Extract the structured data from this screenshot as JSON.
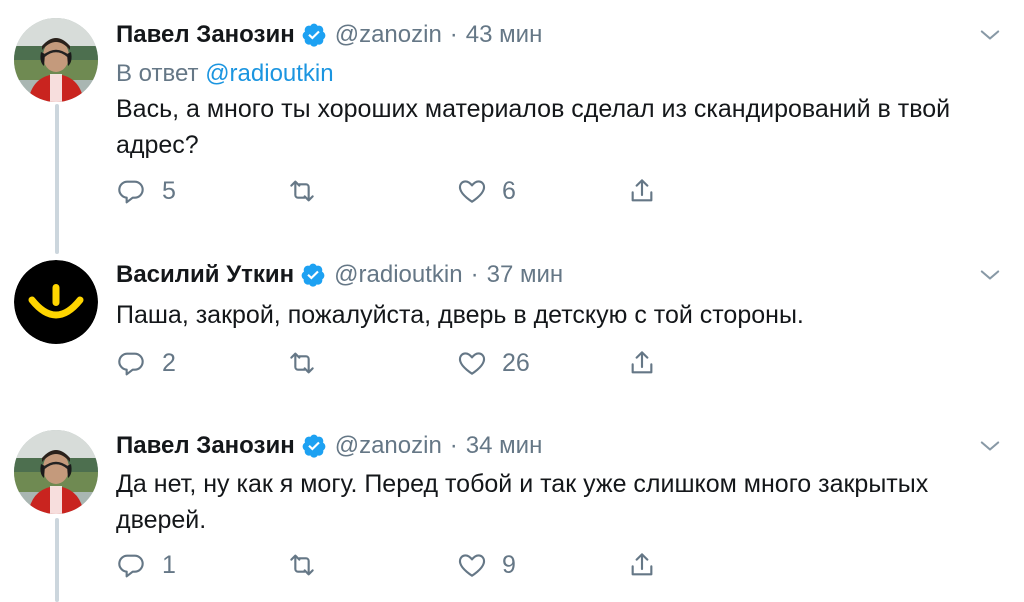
{
  "tweets": [
    {
      "author": "Павел Занозин",
      "handle": "@zanozin",
      "separator": "·",
      "time": "43 мин",
      "reply_prefix": "В ответ",
      "reply_mention": "@radioutkin",
      "text": "Вась, а много ты хороших материалов сделал из скандирований в твой адрес?",
      "replies": "5",
      "retweets": "",
      "likes": "6",
      "avatar_icon": "person-photo-avatar",
      "verified_icon": "verified-badge-icon"
    },
    {
      "author": "Василий Уткин",
      "handle": "@radioutkin",
      "separator": "·",
      "time": "37 мин",
      "text": "Паша, закрой, пожалуйста, дверь в детскую с той стороны.",
      "replies": "2",
      "retweets": "",
      "likes": "26",
      "avatar_icon": "yellow-smile-logo-avatar",
      "verified_icon": "verified-badge-icon"
    },
    {
      "author": "Павел Занозин",
      "handle": "@zanozin",
      "separator": "·",
      "time": "34 мин",
      "text": "Да нет, ну как я могу. Перед тобой и так уже слишком много закрытых дверей.",
      "replies": "1",
      "retweets": "",
      "likes": "9",
      "avatar_icon": "person-photo-avatar",
      "verified_icon": "verified-badge-icon"
    }
  ],
  "colors": {
    "text": "#14171a",
    "secondary": "#657786",
    "link": "#1b95e0",
    "verified": "#1da1f2",
    "thread_line": "#ccd6dd",
    "avatar_brand": "#ffd500"
  }
}
